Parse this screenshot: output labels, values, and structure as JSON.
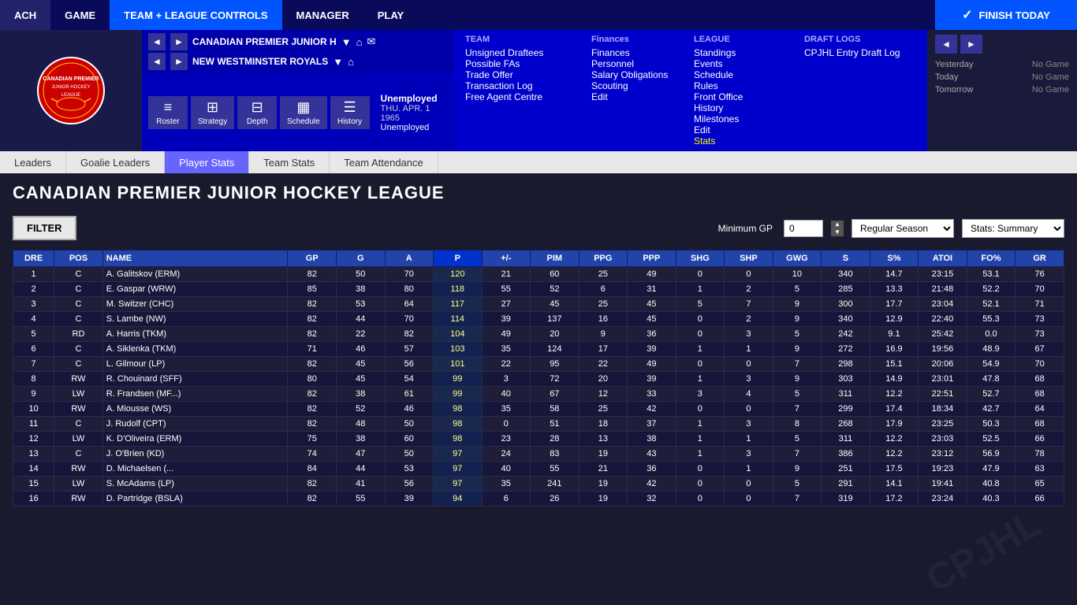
{
  "topnav": {
    "items": [
      {
        "label": "ACH",
        "active": false
      },
      {
        "label": "GAME",
        "active": false
      },
      {
        "label": "TEAM + LEAGUE CONTROLS",
        "active": true
      },
      {
        "label": "MANAGER",
        "active": false
      },
      {
        "label": "PLAY",
        "active": false
      }
    ],
    "finish_today": "FINISH TODAY"
  },
  "nav_left": {
    "team1": "CANADIAN PREMIER JUNIOR H",
    "team2": "NEW WESTMINSTER ROYALS"
  },
  "user": {
    "status": "Unemployed",
    "date": "THU. APR. 1 1965",
    "role": "Unemployed"
  },
  "icon_bar": {
    "roster": "Roster",
    "strategy": "Strategy",
    "depth": "Depth",
    "schedule": "Schedule",
    "history": "History"
  },
  "team_menu": {
    "title": "TEAM",
    "items": [
      "Unsigned Draftees",
      "Possible FAs",
      "Trade Offer",
      "Transaction Log",
      "Free Agent Centre"
    ]
  },
  "finances_menu": {
    "title": "Finances",
    "items": [
      "Finances",
      "Personnel",
      "Salary Obligations",
      "Scouting",
      "Edit"
    ]
  },
  "league_menu": {
    "title": "LEAGUE",
    "items": [
      "Standings",
      "Events",
      "Schedule",
      "Rules",
      "Front Office",
      "History",
      "Milestones",
      "Edit",
      "Stats"
    ]
  },
  "draft_logs": {
    "title": "DRAFT LOGS",
    "link": "CPJHL Entry Draft Log"
  },
  "right_panel": {
    "yesterday": {
      "label": "Yesterday",
      "value": "No Game"
    },
    "today": {
      "label": "Today",
      "value": "No Game"
    },
    "tomorrow": {
      "label": "Tomorrow",
      "value": "No Game"
    }
  },
  "sub_nav": {
    "tabs": [
      {
        "label": "Leaders",
        "active": false
      },
      {
        "label": "Goalie Leaders",
        "active": false
      },
      {
        "label": "Player Stats",
        "active": true
      },
      {
        "label": "Team Stats",
        "active": false
      },
      {
        "label": "Team Attendance",
        "active": false
      }
    ]
  },
  "page_title": "CANADIAN PREMIER JUNIOR HOCKEY LEAGUE",
  "filter": {
    "label": "FILTER",
    "min_gp_label": "Minimum GP",
    "min_gp_value": "0",
    "season": "Regular Season",
    "stats": "Stats: Summary"
  },
  "table": {
    "headers": [
      "DRE",
      "POS",
      "NAME",
      "GP",
      "G",
      "A",
      "P",
      "+/-",
      "PIM",
      "PPG",
      "PPP",
      "SHG",
      "SHP",
      "GWG",
      "S",
      "S%",
      "ATOI",
      "FO%",
      "GR"
    ],
    "rows": [
      {
        "dre": "1",
        "pos": "C",
        "name": "A. Galitskov (ERM)",
        "gp": "82",
        "g": "50",
        "a": "70",
        "p": "120",
        "pm": "21",
        "pim": "60",
        "ppg": "25",
        "ppp": "49",
        "shg": "0",
        "shp": "0",
        "gwg": "10",
        "s": "340",
        "sp": "14.7",
        "atoi": "23:15",
        "fop": "53.1",
        "gr": "76"
      },
      {
        "dre": "2",
        "pos": "C",
        "name": "E. Gaspar (WRW)",
        "gp": "85",
        "g": "38",
        "a": "80",
        "p": "118",
        "pm": "55",
        "pim": "52",
        "ppg": "6",
        "ppp": "31",
        "shg": "1",
        "shp": "2",
        "gwg": "5",
        "s": "285",
        "sp": "13.3",
        "atoi": "21:48",
        "fop": "52.2",
        "gr": "70"
      },
      {
        "dre": "3",
        "pos": "C",
        "name": "M. Switzer (CHC)",
        "gp": "82",
        "g": "53",
        "a": "64",
        "p": "117",
        "pm": "27",
        "pim": "45",
        "ppg": "25",
        "ppp": "45",
        "shg": "5",
        "shp": "7",
        "gwg": "9",
        "s": "300",
        "sp": "17.7",
        "atoi": "23:04",
        "fop": "52.1",
        "gr": "71"
      },
      {
        "dre": "4",
        "pos": "C",
        "name": "S. Lambe (NW)",
        "gp": "82",
        "g": "44",
        "a": "70",
        "p": "114",
        "pm": "39",
        "pim": "137",
        "ppg": "16",
        "ppp": "45",
        "shg": "0",
        "shp": "2",
        "gwg": "9",
        "s": "340",
        "sp": "12.9",
        "atoi": "22:40",
        "fop": "55.3",
        "gr": "73"
      },
      {
        "dre": "5",
        "pos": "RD",
        "name": "A. Harris (TKM)",
        "gp": "82",
        "g": "22",
        "a": "82",
        "p": "104",
        "pm": "49",
        "pim": "20",
        "ppg": "9",
        "ppp": "36",
        "shg": "0",
        "shp": "3",
        "gwg": "5",
        "s": "242",
        "sp": "9.1",
        "atoi": "25:42",
        "fop": "0.0",
        "gr": "73"
      },
      {
        "dre": "6",
        "pos": "C",
        "name": "A. Siklenka (TKM)",
        "gp": "71",
        "g": "46",
        "a": "57",
        "p": "103",
        "pm": "35",
        "pim": "124",
        "ppg": "17",
        "ppp": "39",
        "shg": "1",
        "shp": "1",
        "gwg": "9",
        "s": "272",
        "sp": "16.9",
        "atoi": "19:56",
        "fop": "48.9",
        "gr": "67"
      },
      {
        "dre": "7",
        "pos": "C",
        "name": "L. Gilmour (LP)",
        "gp": "82",
        "g": "45",
        "a": "56",
        "p": "101",
        "pm": "22",
        "pim": "95",
        "ppg": "22",
        "ppp": "49",
        "shg": "0",
        "shp": "0",
        "gwg": "7",
        "s": "298",
        "sp": "15.1",
        "atoi": "20:06",
        "fop": "54.9",
        "gr": "70"
      },
      {
        "dre": "8",
        "pos": "RW",
        "name": "R. Chouinard (SFF)",
        "gp": "80",
        "g": "45",
        "a": "54",
        "p": "99",
        "pm": "3",
        "pim": "72",
        "ppg": "20",
        "ppp": "39",
        "shg": "1",
        "shp": "3",
        "gwg": "9",
        "s": "303",
        "sp": "14.9",
        "atoi": "23:01",
        "fop": "47.8",
        "gr": "68"
      },
      {
        "dre": "9",
        "pos": "LW",
        "name": "R. Frandsen (MF...)",
        "gp": "82",
        "g": "38",
        "a": "61",
        "p": "99",
        "pm": "40",
        "pim": "67",
        "ppg": "12",
        "ppp": "33",
        "shg": "3",
        "shp": "4",
        "gwg": "5",
        "s": "311",
        "sp": "12.2",
        "atoi": "22:51",
        "fop": "52.7",
        "gr": "68"
      },
      {
        "dre": "10",
        "pos": "RW",
        "name": "A. Miousse (WS)",
        "gp": "82",
        "g": "52",
        "a": "46",
        "p": "98",
        "pm": "35",
        "pim": "58",
        "ppg": "25",
        "ppp": "42",
        "shg": "0",
        "shp": "0",
        "gwg": "7",
        "s": "299",
        "sp": "17.4",
        "atoi": "18:34",
        "fop": "42.7",
        "gr": "64"
      },
      {
        "dre": "11",
        "pos": "C",
        "name": "J. Rudolf (CPT)",
        "gp": "82",
        "g": "48",
        "a": "50",
        "p": "98",
        "pm": "0",
        "pim": "51",
        "ppg": "18",
        "ppp": "37",
        "shg": "1",
        "shp": "3",
        "gwg": "8",
        "s": "268",
        "sp": "17.9",
        "atoi": "23:25",
        "fop": "50.3",
        "gr": "68"
      },
      {
        "dre": "12",
        "pos": "LW",
        "name": "K. D'Oliveira (ERM)",
        "gp": "75",
        "g": "38",
        "a": "60",
        "p": "98",
        "pm": "23",
        "pim": "28",
        "ppg": "13",
        "ppp": "38",
        "shg": "1",
        "shp": "1",
        "gwg": "5",
        "s": "311",
        "sp": "12.2",
        "atoi": "23:03",
        "fop": "52.5",
        "gr": "66"
      },
      {
        "dre": "13",
        "pos": "C",
        "name": "J. O'Brien (KD)",
        "gp": "74",
        "g": "47",
        "a": "50",
        "p": "97",
        "pm": "24",
        "pim": "83",
        "ppg": "19",
        "ppp": "43",
        "shg": "1",
        "shp": "3",
        "gwg": "7",
        "s": "386",
        "sp": "12.2",
        "atoi": "23:12",
        "fop": "56.9",
        "gr": "78"
      },
      {
        "dre": "14",
        "pos": "RW",
        "name": "D. Michaelsen (...",
        "gp": "84",
        "g": "44",
        "a": "53",
        "p": "97",
        "pm": "40",
        "pim": "55",
        "ppg": "21",
        "ppp": "36",
        "shg": "0",
        "shp": "1",
        "gwg": "9",
        "s": "251",
        "sp": "17.5",
        "atoi": "19:23",
        "fop": "47.9",
        "gr": "63"
      },
      {
        "dre": "15",
        "pos": "LW",
        "name": "S. McAdams (LP)",
        "gp": "82",
        "g": "41",
        "a": "56",
        "p": "97",
        "pm": "35",
        "pim": "241",
        "ppg": "19",
        "ppp": "42",
        "shg": "0",
        "shp": "0",
        "gwg": "5",
        "s": "291",
        "sp": "14.1",
        "atoi": "19:41",
        "fop": "40.8",
        "gr": "65"
      },
      {
        "dre": "16",
        "pos": "RW",
        "name": "D. Partridge (BSLA)",
        "gp": "82",
        "g": "55",
        "a": "39",
        "p": "94",
        "pm": "6",
        "pim": "26",
        "ppg": "19",
        "ppp": "32",
        "shg": "0",
        "shp": "0",
        "gwg": "7",
        "s": "319",
        "sp": "17.2",
        "atoi": "23:24",
        "fop": "40.3",
        "gr": "66"
      }
    ]
  }
}
